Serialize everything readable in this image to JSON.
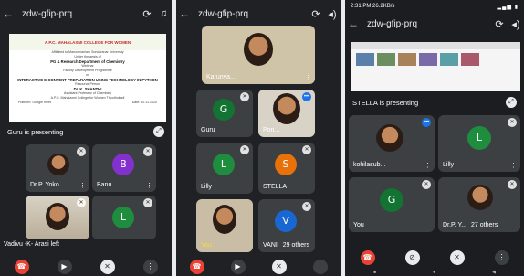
{
  "phone1": {
    "back_icon": "arrow-left",
    "meeting_code": "zdw-gfip-prq",
    "slide": {
      "college": "A.P.C. MAHALAXMI COLLEGE FOR WOMEN",
      "college_sub": "Affiliated to Manonmaniam Sundaranar University",
      "lines": [
        "Under the aegis of",
        "PG & Research Department of Chemistry",
        "Webinar",
        "Faculty Development Programme",
        "on",
        "INTERACTIVE E-CONTENT PREPARATION USING TECHNOLOGY IN PYTHON",
        "Resource Person",
        "Dr. K. SHANTHI",
        "Assistant Professor of Chemistry",
        "A.P.C. Mahalaxmi College for Women Thoothukudi"
      ],
      "footer_left": "Platform: Google meet",
      "footer_right": "Date: 10.11.2020"
    },
    "presenting": "Guru is presenting",
    "tiles": [
      {
        "name": "Dr.P. Yoko..."
      },
      {
        "name": "Banu",
        "initial": "B"
      },
      {
        "name": "Vadivu -K- Arasi left"
      },
      {
        "name": "",
        "initial": "L"
      }
    ]
  },
  "phone2": {
    "meeting_code": "zdw-gfip-prq",
    "tiles": [
      {
        "name": "Karunya..."
      },
      {
        "name": "Guru",
        "initial": "G"
      },
      {
        "name": "Pon..."
      },
      {
        "name": "Lilly",
        "initial": "L"
      },
      {
        "name": "STELLA",
        "initial": "S"
      },
      {
        "name": "You"
      },
      {
        "name": "VANI",
        "initial": "V",
        "others": "29 others"
      }
    ]
  },
  "phone3": {
    "status_time": "2:31 PM  26.2KB/s",
    "meeting_code": "zdw-gfip-prq",
    "presenting": "STELLA is presenting",
    "tiles": [
      {
        "name": "kohilasub..."
      },
      {
        "name": "Lilly",
        "initial": "L"
      },
      {
        "name": "You",
        "initial": "G"
      },
      {
        "name": "Dr.P. Y...",
        "others": "27 others"
      }
    ]
  },
  "colors": {
    "green": "#1e8e3e",
    "purple": "#8430ce",
    "orange": "#e8710a",
    "blue": "#1967d2",
    "teal_green": "#137333",
    "end_call": "#ea4335"
  }
}
